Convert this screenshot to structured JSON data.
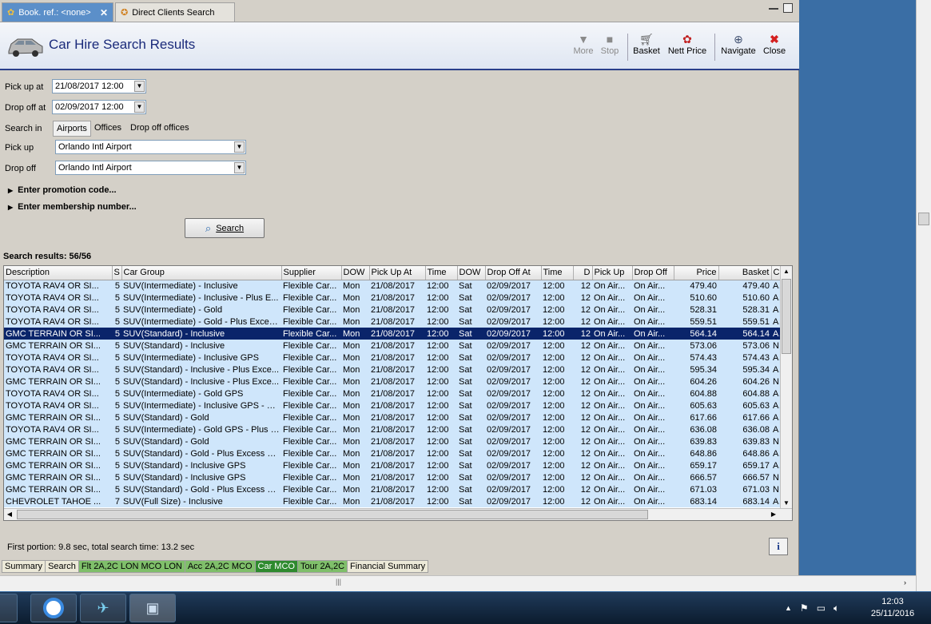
{
  "tabs": [
    {
      "label": "Book. ref.: <none>",
      "icon": "palm-tree-icon",
      "active": true
    },
    {
      "label": "Direct Clients Search",
      "icon": "star-person-icon",
      "active": false
    }
  ],
  "header": {
    "title": "Car Hire Search Results",
    "toolbar": {
      "more": "More",
      "stop": "Stop",
      "basket": "Basket",
      "nett_price": "Nett Price",
      "navigate": "Navigate",
      "close": "Close"
    }
  },
  "form": {
    "pickup_at_label": "Pick up at",
    "pickup_at_value": "21/08/2017 12:00",
    "dropoff_at_label": "Drop off at",
    "dropoff_at_value": "02/09/2017 12:00",
    "search_in_label": "Search in",
    "search_in_options": [
      "Airports",
      "Offices",
      "Drop off offices"
    ],
    "pickup_label": "Pick up",
    "pickup_value": "Orlando Intl Airport",
    "dropoff_label": "Drop off",
    "dropoff_value": "Orlando Intl Airport",
    "promo_label": "Enter promotion code...",
    "membership_label": "Enter membership number...",
    "search_button": "Search"
  },
  "results": {
    "label": "Search results: 56/56",
    "columns": [
      "Description",
      "S",
      "Car Group",
      "Supplier",
      "DOW",
      "Pick Up At",
      "Time",
      "DOW",
      "Drop Off At",
      "Time",
      "D",
      "Pick Up",
      "Drop Off",
      "Price",
      "Basket",
      "Ca"
    ],
    "selected_row": 4,
    "rows": [
      [
        "TOYOTA RAV4 OR SI...",
        "5",
        "SUV(Intermediate) - Inclusive",
        "Flexible Car...",
        "Mon",
        "21/08/2017",
        "12:00",
        "Sat",
        "02/09/2017",
        "12:00",
        "12",
        "On Air...",
        "On Air...",
        "479.40",
        "479.40",
        "Al"
      ],
      [
        "TOYOTA RAV4 OR SI...",
        "5",
        "SUV(Intermediate) - Inclusive - Plus E...",
        "Flexible Car...",
        "Mon",
        "21/08/2017",
        "12:00",
        "Sat",
        "02/09/2017",
        "12:00",
        "12",
        "On Air...",
        "On Air...",
        "510.60",
        "510.60",
        "Al"
      ],
      [
        "TOYOTA RAV4 OR SI...",
        "5",
        "SUV(Intermediate) - Gold",
        "Flexible Car...",
        "Mon",
        "21/08/2017",
        "12:00",
        "Sat",
        "02/09/2017",
        "12:00",
        "12",
        "On Air...",
        "On Air...",
        "528.31",
        "528.31",
        "Al"
      ],
      [
        "TOYOTA RAV4 OR SI...",
        "5",
        "SUV(Intermediate) - Gold - Plus Exces...",
        "Flexible Car...",
        "Mon",
        "21/08/2017",
        "12:00",
        "Sat",
        "02/09/2017",
        "12:00",
        "12",
        "On Air...",
        "On Air...",
        "559.51",
        "559.51",
        "Al"
      ],
      [
        "GMC TERRAIN OR SI...",
        "5",
        "SUV(Standard) - Inclusive",
        "Flexible Car...",
        "Mon",
        "21/08/2017",
        "12:00",
        "Sat",
        "02/09/2017",
        "12:00",
        "12",
        "On Air...",
        "On Air...",
        "564.14",
        "564.14",
        "Al"
      ],
      [
        "GMC TERRAIN OR SI...",
        "5",
        "SUV(Standard) - Inclusive",
        "Flexible Car...",
        "Mon",
        "21/08/2017",
        "12:00",
        "Sat",
        "02/09/2017",
        "12:00",
        "12",
        "On Air...",
        "On Air...",
        "573.06",
        "573.06",
        "Na"
      ],
      [
        "TOYOTA RAV4 OR SI...",
        "5",
        "SUV(Intermediate) - Inclusive GPS",
        "Flexible Car...",
        "Mon",
        "21/08/2017",
        "12:00",
        "Sat",
        "02/09/2017",
        "12:00",
        "12",
        "On Air...",
        "On Air...",
        "574.43",
        "574.43",
        "Al"
      ],
      [
        "TOYOTA RAV4 OR SI...",
        "5",
        "SUV(Standard) - Inclusive - Plus Exce...",
        "Flexible Car...",
        "Mon",
        "21/08/2017",
        "12:00",
        "Sat",
        "02/09/2017",
        "12:00",
        "12",
        "On Air...",
        "On Air...",
        "595.34",
        "595.34",
        "Al"
      ],
      [
        "GMC TERRAIN OR SI...",
        "5",
        "SUV(Standard) - Inclusive - Plus Exce...",
        "Flexible Car...",
        "Mon",
        "21/08/2017",
        "12:00",
        "Sat",
        "02/09/2017",
        "12:00",
        "12",
        "On Air...",
        "On Air...",
        "604.26",
        "604.26",
        "Na"
      ],
      [
        "TOYOTA RAV4 OR SI...",
        "5",
        "SUV(Intermediate) - Gold GPS",
        "Flexible Car...",
        "Mon",
        "21/08/2017",
        "12:00",
        "Sat",
        "02/09/2017",
        "12:00",
        "12",
        "On Air...",
        "On Air...",
        "604.88",
        "604.88",
        "Al"
      ],
      [
        "TOYOTA RAV4 OR SI...",
        "5",
        "SUV(Intermediate) - Inclusive GPS - Pl...",
        "Flexible Car...",
        "Mon",
        "21/08/2017",
        "12:00",
        "Sat",
        "02/09/2017",
        "12:00",
        "12",
        "On Air...",
        "On Air...",
        "605.63",
        "605.63",
        "Al"
      ],
      [
        "GMC TERRAIN OR SI...",
        "5",
        "SUV(Standard) - Gold",
        "Flexible Car...",
        "Mon",
        "21/08/2017",
        "12:00",
        "Sat",
        "02/09/2017",
        "12:00",
        "12",
        "On Air...",
        "On Air...",
        "617.66",
        "617.66",
        "Al"
      ],
      [
        "TOYOTA RAV4 OR SI...",
        "5",
        "SUV(Intermediate) - Gold GPS - Plus E...",
        "Flexible Car...",
        "Mon",
        "21/08/2017",
        "12:00",
        "Sat",
        "02/09/2017",
        "12:00",
        "12",
        "On Air...",
        "On Air...",
        "636.08",
        "636.08",
        "Al"
      ],
      [
        "GMC TERRAIN OR SI...",
        "5",
        "SUV(Standard) - Gold",
        "Flexible Car...",
        "Mon",
        "21/08/2017",
        "12:00",
        "Sat",
        "02/09/2017",
        "12:00",
        "12",
        "On Air...",
        "On Air...",
        "639.83",
        "639.83",
        "Na"
      ],
      [
        "GMC TERRAIN OR SI...",
        "5",
        "SUV(Standard) - Gold - Plus Excess R...",
        "Flexible Car...",
        "Mon",
        "21/08/2017",
        "12:00",
        "Sat",
        "02/09/2017",
        "12:00",
        "12",
        "On Air...",
        "On Air...",
        "648.86",
        "648.86",
        "Al"
      ],
      [
        "GMC TERRAIN OR SI...",
        "5",
        "SUV(Standard) - Inclusive GPS",
        "Flexible Car...",
        "Mon",
        "21/08/2017",
        "12:00",
        "Sat",
        "02/09/2017",
        "12:00",
        "12",
        "On Air...",
        "On Air...",
        "659.17",
        "659.17",
        "Al"
      ],
      [
        "GMC TERRAIN OR SI...",
        "5",
        "SUV(Standard) - Inclusive GPS",
        "Flexible Car...",
        "Mon",
        "21/08/2017",
        "12:00",
        "Sat",
        "02/09/2017",
        "12:00",
        "12",
        "On Air...",
        "On Air...",
        "666.57",
        "666.57",
        "Na"
      ],
      [
        "GMC TERRAIN OR SI...",
        "5",
        "SUV(Standard) - Gold - Plus Excess R...",
        "Flexible Car...",
        "Mon",
        "21/08/2017",
        "12:00",
        "Sat",
        "02/09/2017",
        "12:00",
        "12",
        "On Air...",
        "On Air...",
        "671.03",
        "671.03",
        "Na"
      ],
      [
        "CHEVROLET TAHOE ...",
        "7",
        "SUV(Full Size) - Inclusive",
        "Flexible Car...",
        "Mon",
        "21/08/2017",
        "12:00",
        "Sat",
        "02/09/2017",
        "12:00",
        "12",
        "On Air...",
        "On Air...",
        "683.14",
        "683.14",
        "Al"
      ]
    ]
  },
  "status": {
    "timing_text": "First portion: 9.8 sec, total search time: 13.2 sec",
    "info_button": "i"
  },
  "bottom_tabs": [
    {
      "label": "Summary",
      "style": "plain"
    },
    {
      "label": "Search",
      "style": "plain"
    },
    {
      "label": "Flt 2A,2C LON MCO LON",
      "style": "green"
    },
    {
      "label": "Acc 2A,2C MCO",
      "style": "green"
    },
    {
      "label": "Car MCO",
      "style": "active"
    },
    {
      "label": "Tour 2A,2C",
      "style": "green"
    },
    {
      "label": "Financial Summary",
      "style": "plain"
    }
  ],
  "taskbar": {
    "time": "12:03",
    "date": "25/11/2016"
  },
  "colors": {
    "header_title": "#1a2a7a",
    "selected_row": "#0a246a",
    "row_background": "#cfe6fb",
    "active_tab": "#2e8a2e",
    "green_tab": "#7fbf6a",
    "close_red": "#d42020"
  }
}
